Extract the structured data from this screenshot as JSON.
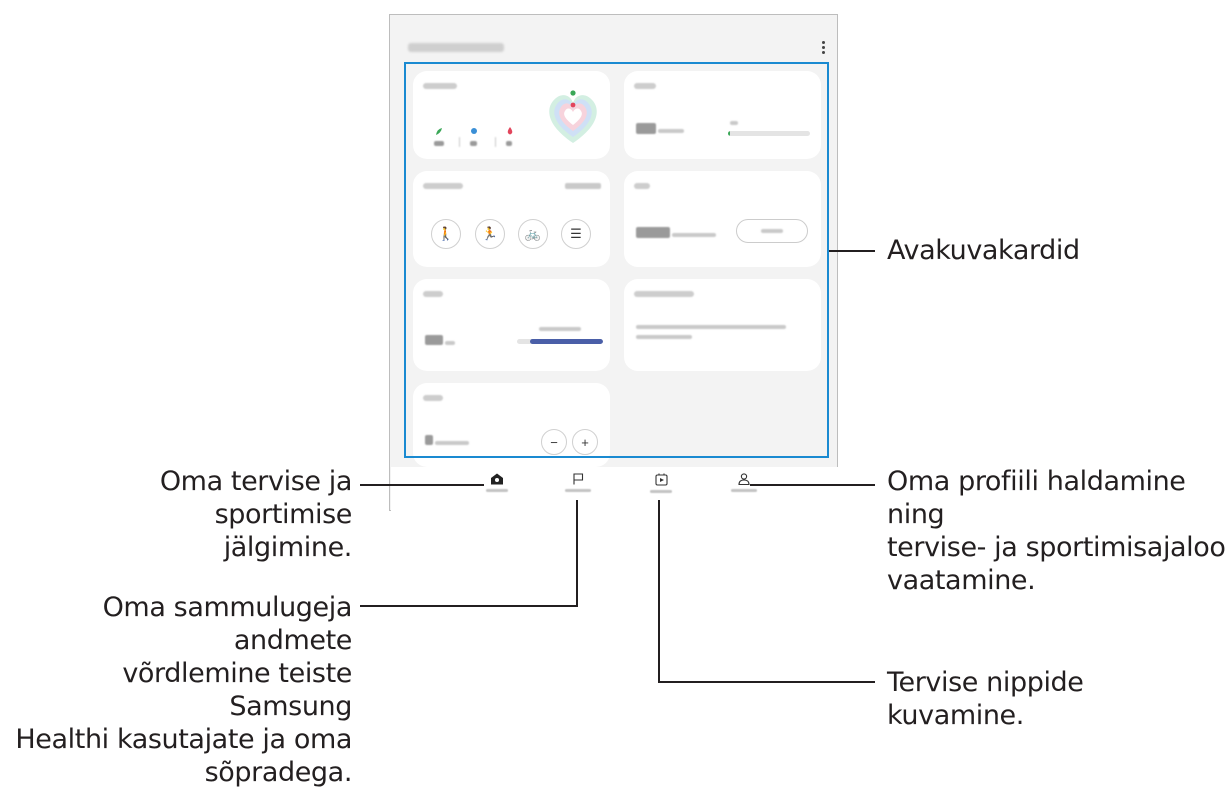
{
  "callouts": {
    "home_cards": "Avakuvakardid",
    "home_tab_line1": "Oma tervise ja sportimise",
    "home_tab_line2": "jälgimine.",
    "together_line1": "Oma sammulugeja andmete",
    "together_line2": "võrdlemine teiste Samsung",
    "together_line3": "Healthi kasutajate ja oma",
    "together_line4": "sõpradega.",
    "mypage_line1": "Oma profiili haldamine ning",
    "mypage_line2": "tervise- ja sportimisajaloo",
    "mypage_line3": "vaatamine.",
    "discover": "Tervise nippide kuvamine."
  },
  "cards": {
    "steps_level": 0.02,
    "sleep_level": 0.85
  },
  "icons": {
    "menu": "more-vertical-icon",
    "walk": "walking-icon",
    "run": "running-icon",
    "bike": "cycling-icon",
    "list": "list-icon",
    "minus": "minus-icon",
    "plus": "plus-icon",
    "home": "home-icon",
    "together": "flag-icon",
    "discover": "play-calendar-icon",
    "my_page": "person-icon"
  },
  "colors": {
    "highlight": "#1a8ad1",
    "sleep_bar": "#4a5fa8",
    "steps_bar": "#3aa757",
    "activity_green": "#3aa757",
    "activity_blue": "#3a8fd6",
    "activity_red": "#e2455c"
  }
}
